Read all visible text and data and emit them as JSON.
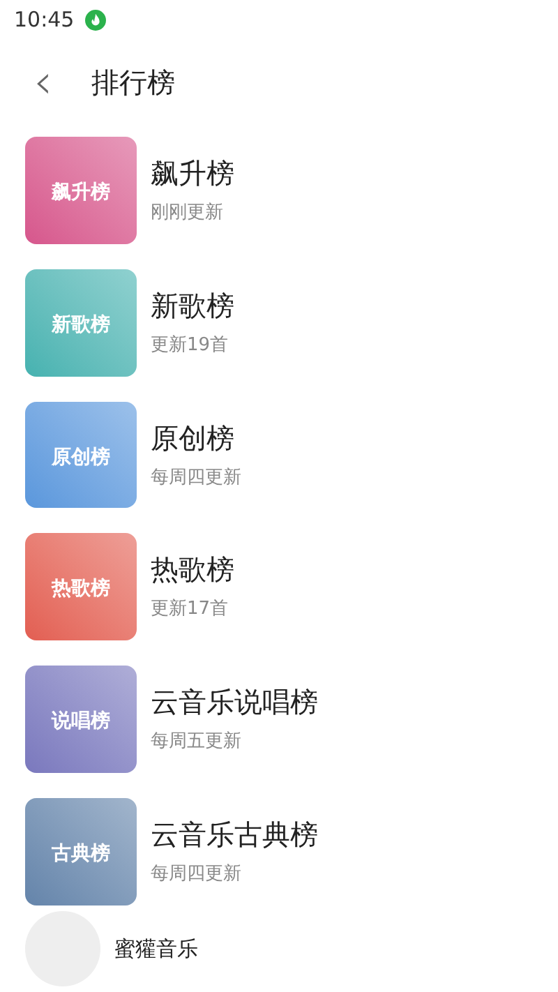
{
  "status_bar": {
    "time": "10:45"
  },
  "header": {
    "back": "‹",
    "title": "排行榜"
  },
  "charts": [
    {
      "cover_label": "飙升榜",
      "title": "飙升榜",
      "subtitle": "刚刚更新",
      "color": "#d6568c"
    },
    {
      "cover_label": "新歌榜",
      "title": "新歌榜",
      "subtitle": "更新19首",
      "color": "#45b2b0"
    },
    {
      "cover_label": "原创榜",
      "title": "原创榜",
      "subtitle": "每周四更新",
      "color": "#5a97dc"
    },
    {
      "cover_label": "热歌榜",
      "title": "热歌榜",
      "subtitle": "更新17首",
      "color": "#e25e52"
    },
    {
      "cover_label": "说唱榜",
      "title": "云音乐说唱榜",
      "subtitle": "每周五更新",
      "color": "#7a78bd"
    },
    {
      "cover_label": "古典榜",
      "title": "云音乐古典榜",
      "subtitle": "每周四更新",
      "color": "#6484aa"
    }
  ],
  "player": {
    "track": "蜜獾音乐"
  }
}
